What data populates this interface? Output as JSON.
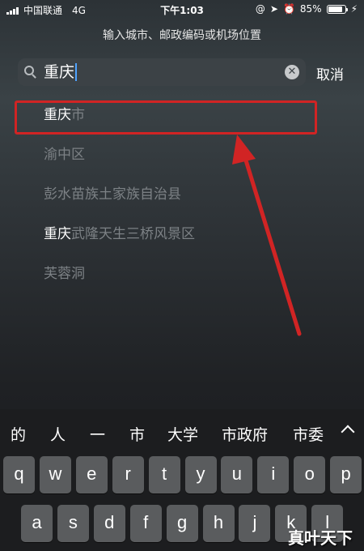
{
  "status_bar": {
    "carrier": "中国联通",
    "network": "4G",
    "time": "下午1:03",
    "battery_percent": "85%",
    "battery_level": 0.85,
    "icons": [
      "signal-icon",
      "at-icon",
      "location-icon",
      "alarm-icon",
      "battery-icon",
      "charging-icon"
    ]
  },
  "prompt": "输入城市、邮政编码或机场位置",
  "search": {
    "value": "重庆",
    "clear_icon": "✕",
    "cancel_label": "取消"
  },
  "results": [
    {
      "match": "重庆",
      "rest": "市"
    },
    {
      "match": "",
      "rest": "渝中区"
    },
    {
      "match": "",
      "rest": "彭水苗族土家族自治县"
    },
    {
      "match": "重庆",
      "rest": "武隆天生三桥风景区"
    },
    {
      "match": "",
      "rest": "芙蓉洞"
    }
  ],
  "annotation": {
    "color": "#d12424"
  },
  "suggestions": [
    "的",
    "人",
    "一",
    "市",
    "大学",
    "市政府",
    "市委"
  ],
  "keyboard": {
    "row1": [
      "q",
      "w",
      "e",
      "r",
      "t",
      "y",
      "u",
      "i",
      "o",
      "p"
    ],
    "row2": [
      "a",
      "s",
      "d",
      "f",
      "g",
      "h",
      "j",
      "k",
      "l"
    ]
  },
  "watermark": "真叶天下"
}
